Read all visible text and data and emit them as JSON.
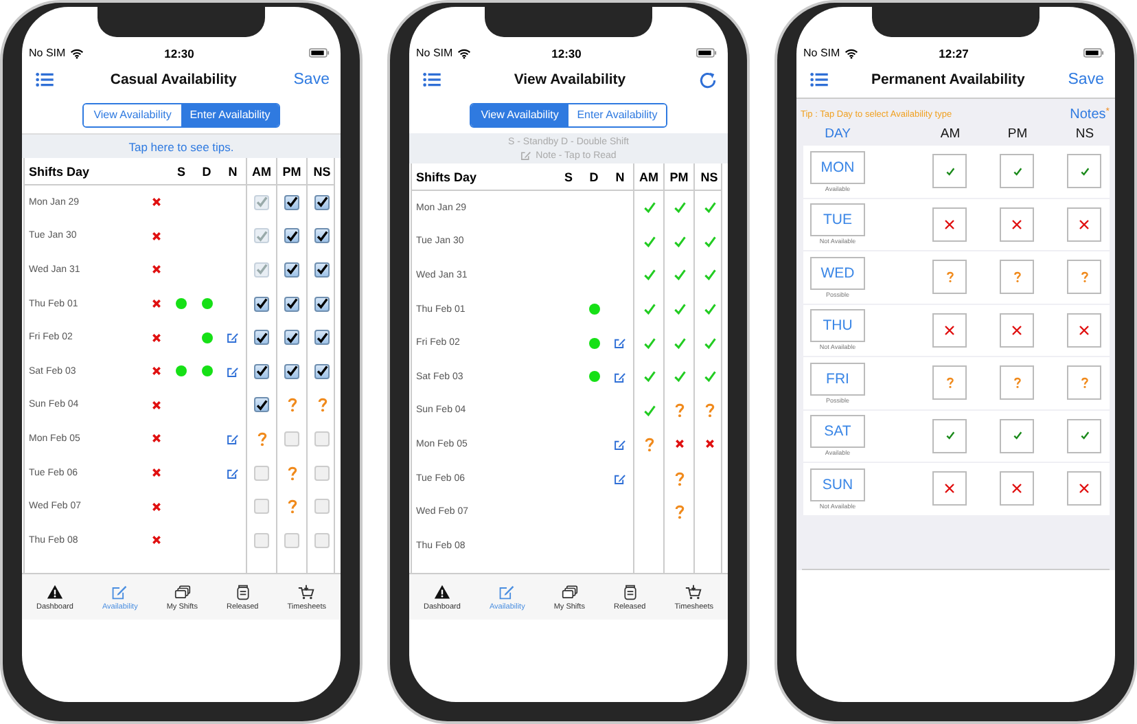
{
  "screens": [
    {
      "kind": "casual",
      "status": {
        "carrier": "No SIM",
        "time": "12:30"
      },
      "title": "Casual Availability",
      "action": {
        "kind": "text",
        "label": "Save"
      },
      "segments": [
        {
          "label": "View Availability",
          "selected": false
        },
        {
          "label": "Enter Availability",
          "selected": true
        }
      ],
      "tip": "Tap here to see tips.",
      "columns": [
        "Shifts Day",
        "S",
        "D",
        "N",
        "AM",
        "PM",
        "NS"
      ],
      "rows": [
        {
          "day": "Mon Jan 29",
          "unavailable": true,
          "standby": false,
          "double": false,
          "note": false,
          "shifts": [
            {
              "kind": "locked"
            },
            {
              "kind": "checked"
            },
            {
              "kind": "checked"
            }
          ]
        },
        {
          "day": "Tue Jan 30",
          "unavailable": true,
          "standby": false,
          "double": false,
          "note": false,
          "shifts": [
            {
              "kind": "locked"
            },
            {
              "kind": "checked"
            },
            {
              "kind": "checked"
            }
          ]
        },
        {
          "day": "Wed Jan 31",
          "unavailable": true,
          "standby": false,
          "double": false,
          "note": false,
          "shifts": [
            {
              "kind": "locked"
            },
            {
              "kind": "checked"
            },
            {
              "kind": "checked"
            }
          ]
        },
        {
          "day": "Thu Feb 01",
          "unavailable": true,
          "standby": true,
          "double": true,
          "note": false,
          "shifts": [
            {
              "kind": "checked"
            },
            {
              "kind": "checked"
            },
            {
              "kind": "checked"
            }
          ]
        },
        {
          "day": "Fri Feb 02",
          "unavailable": true,
          "standby": false,
          "double": true,
          "note": true,
          "shifts": [
            {
              "kind": "checked"
            },
            {
              "kind": "checked"
            },
            {
              "kind": "checked"
            }
          ]
        },
        {
          "day": "Sat Feb 03",
          "unavailable": true,
          "standby": true,
          "double": true,
          "note": true,
          "shifts": [
            {
              "kind": "checked"
            },
            {
              "kind": "checked"
            },
            {
              "kind": "checked"
            }
          ]
        },
        {
          "day": "Sun Feb 04",
          "unavailable": true,
          "standby": false,
          "double": false,
          "note": false,
          "shifts": [
            {
              "kind": "checked"
            },
            {
              "kind": "maybe"
            },
            {
              "kind": "maybe"
            }
          ]
        },
        {
          "day": "Mon Feb 05",
          "unavailable": true,
          "standby": false,
          "double": false,
          "note": true,
          "shifts": [
            {
              "kind": "maybe"
            },
            {
              "kind": "empty"
            },
            {
              "kind": "empty"
            }
          ]
        },
        {
          "day": "Tue Feb 06",
          "unavailable": true,
          "standby": false,
          "double": false,
          "note": true,
          "shifts": [
            {
              "kind": "empty"
            },
            {
              "kind": "maybe"
            },
            {
              "kind": "empty"
            }
          ]
        },
        {
          "day": "Wed Feb 07",
          "unavailable": true,
          "standby": false,
          "double": false,
          "note": false,
          "shifts": [
            {
              "kind": "empty"
            },
            {
              "kind": "maybe"
            },
            {
              "kind": "empty"
            }
          ]
        },
        {
          "day": "Thu Feb 08",
          "unavailable": true,
          "standby": false,
          "double": false,
          "note": false,
          "shifts": [
            {
              "kind": "empty"
            },
            {
              "kind": "empty"
            },
            {
              "kind": "empty"
            }
          ]
        }
      ],
      "tabs": [
        {
          "kind": "dashboard",
          "label": "Dashboard",
          "selected": false
        },
        {
          "kind": "availability",
          "label": "Availability",
          "selected": true
        },
        {
          "kind": "shifts",
          "label": "My Shifts",
          "selected": false
        },
        {
          "kind": "released",
          "label": "Released",
          "selected": false
        },
        {
          "kind": "timesheets",
          "label": "Timesheets",
          "selected": false
        }
      ]
    },
    {
      "kind": "view",
      "status": {
        "carrier": "No SIM",
        "time": "12:30"
      },
      "title": "View Availability",
      "action": {
        "kind": "refresh"
      },
      "segments": [
        {
          "label": "View Availability",
          "selected": true
        },
        {
          "label": "Enter Availability",
          "selected": false
        }
      ],
      "legend": [
        "S - Standby D - Double Shift",
        "Note - Tap to Read"
      ],
      "columns": [
        "Shifts Day",
        "S",
        "D",
        "N",
        "AM",
        "PM",
        "NS"
      ],
      "rows": [
        {
          "day": "Mon Jan 29",
          "unavailable": false,
          "standby": false,
          "double": false,
          "note": false,
          "shifts": [
            {
              "kind": "yes"
            },
            {
              "kind": "yes"
            },
            {
              "kind": "yes"
            }
          ]
        },
        {
          "day": "Tue Jan 30",
          "unavailable": false,
          "standby": false,
          "double": false,
          "note": false,
          "shifts": [
            {
              "kind": "yes"
            },
            {
              "kind": "yes"
            },
            {
              "kind": "yes"
            }
          ]
        },
        {
          "day": "Wed Jan 31",
          "unavailable": false,
          "standby": false,
          "double": false,
          "note": false,
          "shifts": [
            {
              "kind": "yes"
            },
            {
              "kind": "yes"
            },
            {
              "kind": "yes"
            }
          ]
        },
        {
          "day": "Thu Feb 01",
          "unavailable": false,
          "standby": false,
          "double": true,
          "note": false,
          "shifts": [
            {
              "kind": "yes"
            },
            {
              "kind": "yes"
            },
            {
              "kind": "yes"
            }
          ]
        },
        {
          "day": "Fri Feb 02",
          "unavailable": false,
          "standby": false,
          "double": true,
          "note": true,
          "shifts": [
            {
              "kind": "yes"
            },
            {
              "kind": "yes"
            },
            {
              "kind": "yes"
            }
          ]
        },
        {
          "day": "Sat Feb 03",
          "unavailable": false,
          "standby": false,
          "double": true,
          "note": true,
          "shifts": [
            {
              "kind": "yes"
            },
            {
              "kind": "yes"
            },
            {
              "kind": "yes"
            }
          ]
        },
        {
          "day": "Sun Feb 04",
          "unavailable": false,
          "standby": false,
          "double": false,
          "note": false,
          "shifts": [
            {
              "kind": "yes"
            },
            {
              "kind": "maybe"
            },
            {
              "kind": "maybe"
            }
          ]
        },
        {
          "day": "Mon Feb 05",
          "unavailable": false,
          "standby": false,
          "double": false,
          "note": true,
          "shifts": [
            {
              "kind": "maybe"
            },
            {
              "kind": "no"
            },
            {
              "kind": "no"
            }
          ]
        },
        {
          "day": "Tue Feb 06",
          "unavailable": false,
          "standby": false,
          "double": false,
          "note": true,
          "shifts": [
            {
              "kind": "blank"
            },
            {
              "kind": "maybe"
            },
            {
              "kind": "blank"
            }
          ]
        },
        {
          "day": "Wed Feb 07",
          "unavailable": false,
          "standby": false,
          "double": false,
          "note": false,
          "shifts": [
            {
              "kind": "blank"
            },
            {
              "kind": "maybe"
            },
            {
              "kind": "blank"
            }
          ]
        },
        {
          "day": "Thu Feb 08",
          "unavailable": false,
          "standby": false,
          "double": false,
          "note": false,
          "shifts": [
            {
              "kind": "blank"
            },
            {
              "kind": "blank"
            },
            {
              "kind": "blank"
            }
          ]
        }
      ],
      "tabs": [
        {
          "kind": "dashboard",
          "label": "Dashboard",
          "selected": false
        },
        {
          "kind": "availability",
          "label": "Availability",
          "selected": true
        },
        {
          "kind": "shifts",
          "label": "My Shifts",
          "selected": false
        },
        {
          "kind": "released",
          "label": "Released",
          "selected": false
        },
        {
          "kind": "timesheets",
          "label": "Timesheets",
          "selected": false
        }
      ]
    },
    {
      "kind": "permanent",
      "status": {
        "carrier": "No SIM",
        "time": "12:27"
      },
      "title": "Permanent Availability",
      "action": {
        "kind": "text",
        "label": "Save"
      },
      "tip": "Tip : Tap Day to select Availability type",
      "notes": {
        "label": "Notes",
        "marker": "*"
      },
      "columns": [
        "DAY",
        "AM",
        "PM",
        "NS"
      ],
      "days": [
        {
          "day": "MON",
          "status": "Available",
          "shifts": [
            {
              "kind": "yes"
            },
            {
              "kind": "yes"
            },
            {
              "kind": "yes"
            }
          ]
        },
        {
          "day": "TUE",
          "status": "Not Available",
          "shifts": [
            {
              "kind": "no"
            },
            {
              "kind": "no"
            },
            {
              "kind": "no"
            }
          ]
        },
        {
          "day": "WED",
          "status": "Possible",
          "shifts": [
            {
              "kind": "maybe"
            },
            {
              "kind": "maybe"
            },
            {
              "kind": "maybe"
            }
          ]
        },
        {
          "day": "THU",
          "status": "Not Available",
          "shifts": [
            {
              "kind": "no"
            },
            {
              "kind": "no"
            },
            {
              "kind": "no"
            }
          ]
        },
        {
          "day": "FRI",
          "status": "Possible",
          "shifts": [
            {
              "kind": "maybe"
            },
            {
              "kind": "maybe"
            },
            {
              "kind": "maybe"
            }
          ]
        },
        {
          "day": "SAT",
          "status": "Available",
          "shifts": [
            {
              "kind": "yes"
            },
            {
              "kind": "yes"
            },
            {
              "kind": "yes"
            }
          ]
        },
        {
          "day": "SUN",
          "status": "Not Available",
          "shifts": [
            {
              "kind": "no"
            },
            {
              "kind": "no"
            },
            {
              "kind": "no"
            }
          ]
        }
      ]
    }
  ]
}
